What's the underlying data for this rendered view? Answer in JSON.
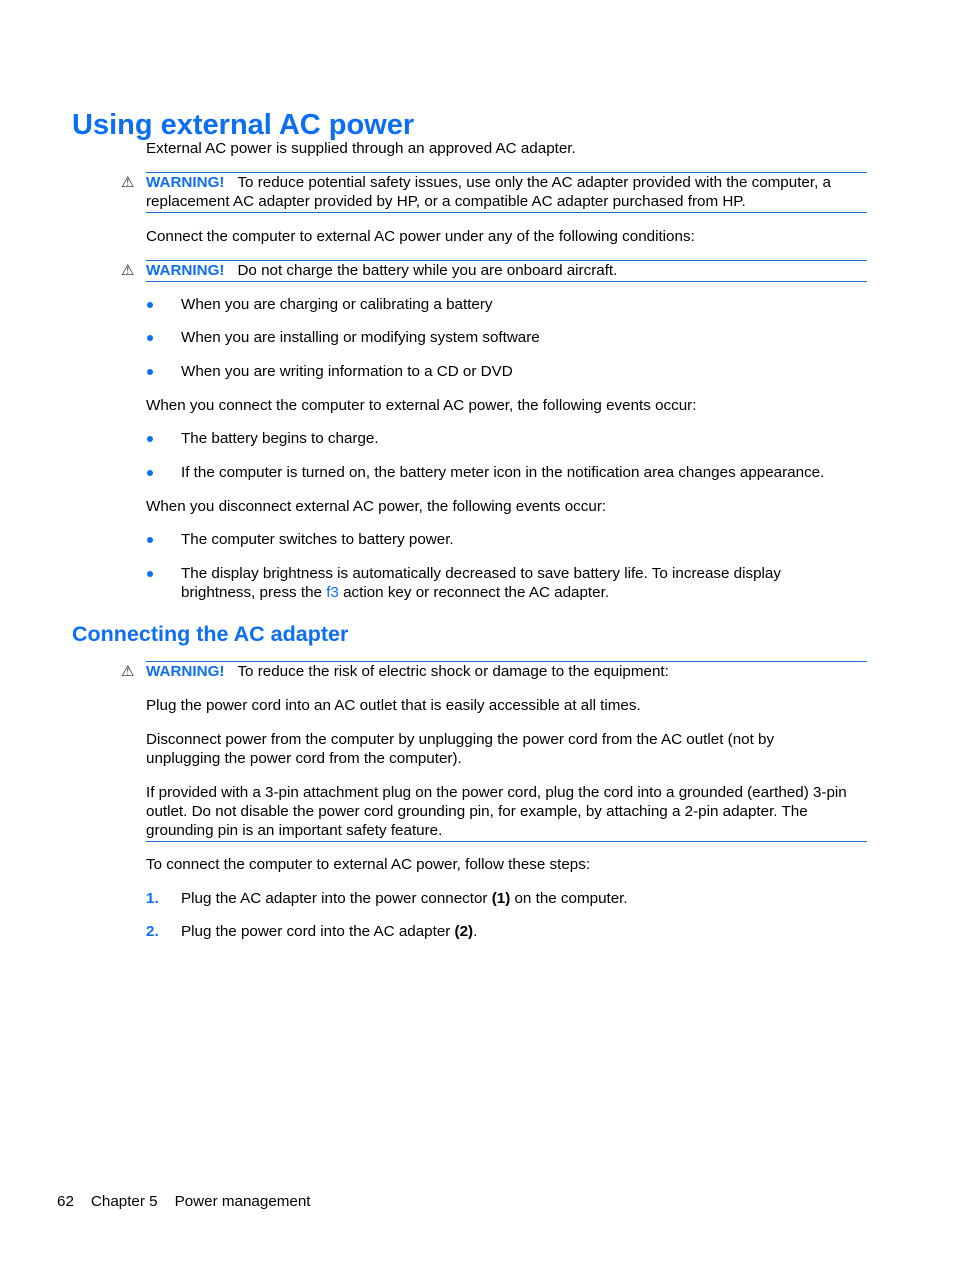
{
  "page": {
    "title": "Using external AC power",
    "intro": "External AC power is supplied through an approved AC adapter.",
    "warning_label": "WARNING!",
    "warnings": {
      "adapter": "To reduce potential safety issues, use only the AC adapter provided with the computer, a replacement AC adapter provided by HP, or a compatible AC adapter purchased from HP.",
      "aircraft": "Do not charge the battery while you are onboard aircraft.",
      "shock": "To reduce the risk of electric shock or damage to the equipment:"
    },
    "conditions_intro": "Connect the computer to external AC power under any of the following conditions:",
    "conditions": [
      "When you are charging or calibrating a battery",
      "When you are installing or modifying system software",
      "When you are writing information to a CD or DVD"
    ],
    "connect_intro": "When you connect the computer to external AC power, the following events occur:",
    "connect_events": [
      "The battery begins to charge.",
      "If the computer is turned on, the battery meter icon in the notification area changes appearance."
    ],
    "disconnect_intro": "When you disconnect external AC power, the following events occur:",
    "disconnect_events": {
      "first": "The computer switches to battery power.",
      "second_before": "The display brightness is automatically decreased to save battery life. To increase display brightness, press the ",
      "second_key": "f3",
      "second_after": " action key or reconnect the AC adapter."
    },
    "section2_title": "Connecting the AC adapter",
    "warning_paras": [
      "Plug the power cord into an AC outlet that is easily accessible at all times.",
      "Disconnect power from the computer by unplugging the power cord from the AC outlet (not by unplugging the power cord from the computer).",
      "If provided with a 3-pin attachment plug on the power cord, plug the cord into a grounded (earthed) 3-pin outlet. Do not disable the power cord grounding pin, for example, by attaching a 2-pin adapter. The grounding pin is an important safety feature."
    ],
    "steps_intro": "To connect the computer to external AC power, follow these steps:",
    "steps": [
      {
        "num": "1.",
        "before": "Plug the AC adapter into the power connector ",
        "bold": "(1)",
        "after": " on the computer."
      },
      {
        "num": "2.",
        "before": "Plug the power cord into the AC adapter ",
        "bold": "(2)",
        "after": "."
      }
    ]
  },
  "footer": {
    "page_number": "62",
    "chapter": "Chapter 5",
    "chapter_title": "Power management"
  },
  "icons": {
    "warning": "⚠"
  },
  "colors": {
    "accent": "#0b6ef5",
    "rule": "#1a6fd6"
  }
}
